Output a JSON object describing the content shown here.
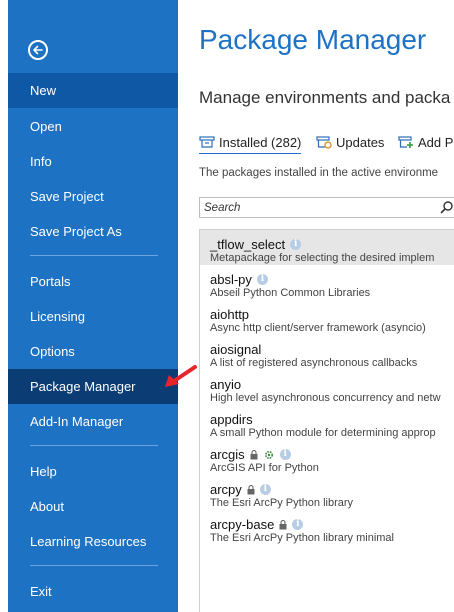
{
  "nav": {
    "items": [
      {
        "label": "New"
      },
      {
        "label": "Open"
      },
      {
        "label": "Info"
      },
      {
        "label": "Save Project"
      },
      {
        "label": "Save Project As"
      },
      {
        "label": "Portals"
      },
      {
        "label": "Licensing"
      },
      {
        "label": "Options"
      },
      {
        "label": "Package Manager"
      },
      {
        "label": "Add-In Manager"
      },
      {
        "label": "Help"
      },
      {
        "label": "About"
      },
      {
        "label": "Learning Resources"
      },
      {
        "label": "Exit"
      }
    ],
    "selected": "New",
    "active": "Package Manager"
  },
  "main": {
    "title": "Package Manager",
    "subtitle": "Manage environments and packa",
    "tabs": [
      {
        "label": "Installed (282)"
      },
      {
        "label": "Updates"
      },
      {
        "label": "Add P"
      }
    ],
    "description": "The packages installed in the active environme",
    "search": {
      "placeholder": "Search"
    },
    "packages": [
      {
        "name": "_tflow_select",
        "desc": "Metapackage for selecting the desired implem"
      },
      {
        "name": "absl-py",
        "desc": "Abseil Python Common Libraries"
      },
      {
        "name": "aiohttp",
        "desc": "Async http client/server framework (asyncio)"
      },
      {
        "name": "aiosignal",
        "desc": "A list of registered asynchronous callbacks"
      },
      {
        "name": "anyio",
        "desc": "High level asynchronous concurrency and netw"
      },
      {
        "name": "appdirs",
        "desc": "A small Python module for determining approp"
      },
      {
        "name": "arcgis",
        "desc": "ArcGIS API for Python"
      },
      {
        "name": "arcpy",
        "desc": "The Esri ArcPy Python library"
      },
      {
        "name": "arcpy-base",
        "desc": "The Esri ArcPy Python library minimal"
      }
    ]
  },
  "colors": {
    "nav_bg": "#1d72c4",
    "nav_selected": "#0f58a6",
    "nav_active": "#0b3c73",
    "title": "#1d72c4",
    "annotation_arrow": "#e8242b"
  }
}
